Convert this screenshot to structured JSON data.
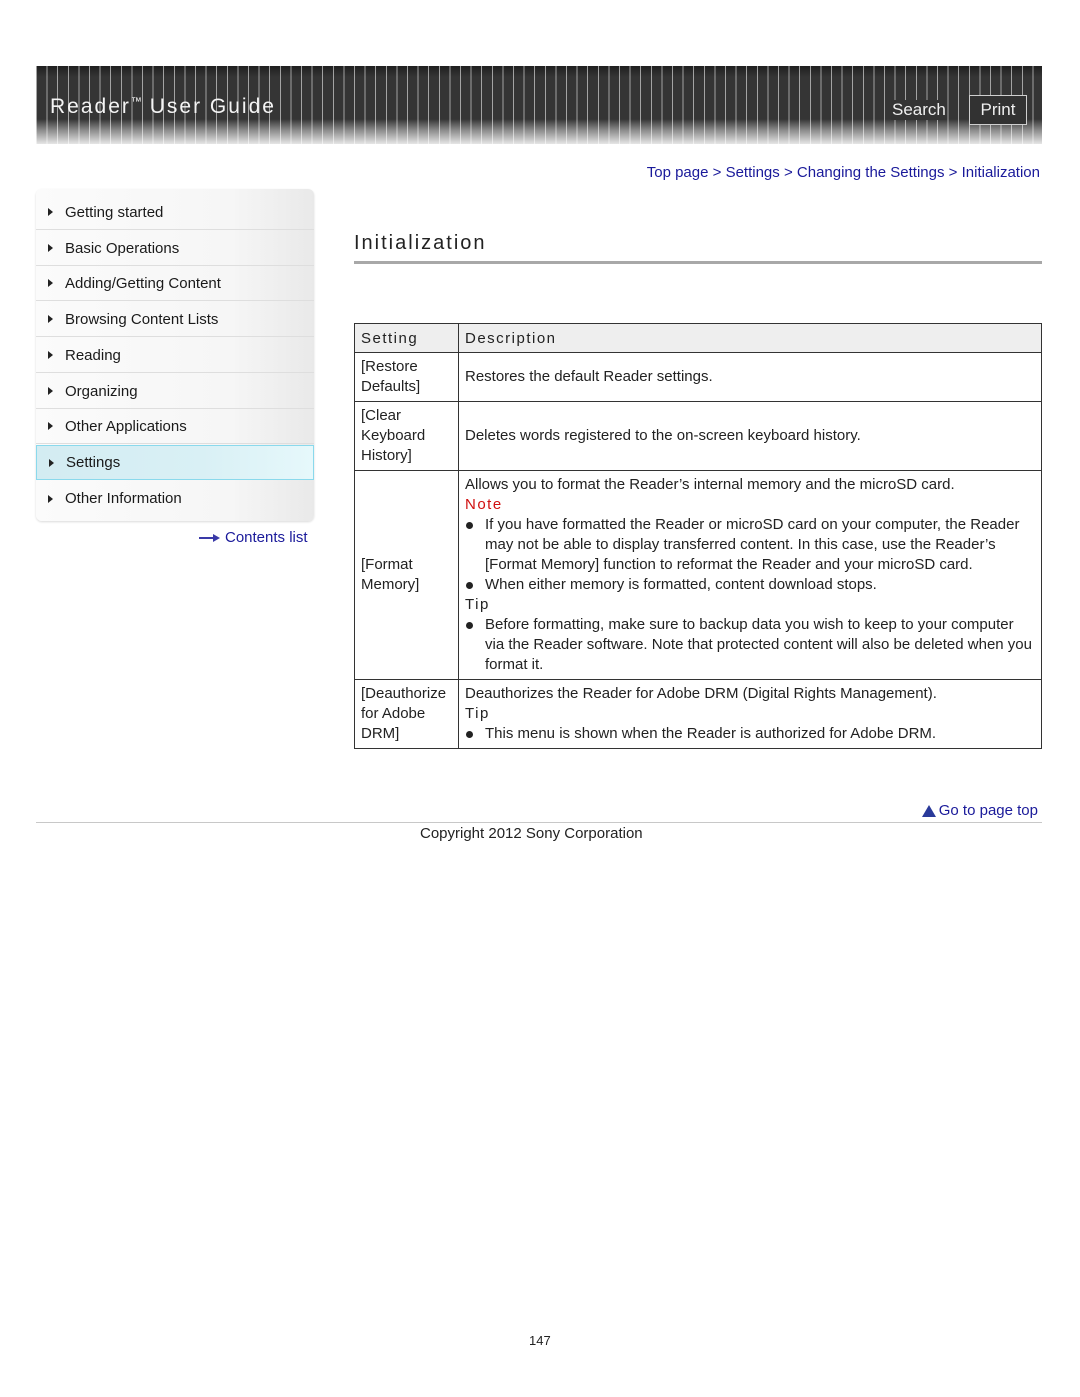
{
  "header": {
    "title_main": "Reader",
    "title_tm": "™",
    "title_rest": "User Guide",
    "search_label": "Search",
    "print_label": "Print"
  },
  "sidebar": {
    "items": [
      {
        "label": "Getting started",
        "active": false
      },
      {
        "label": "Basic Operations",
        "active": false
      },
      {
        "label": "Adding/Getting Content",
        "active": false
      },
      {
        "label": "Browsing Content Lists",
        "active": false
      },
      {
        "label": "Reading",
        "active": false
      },
      {
        "label": "Organizing",
        "active": false
      },
      {
        "label": "Other Applications",
        "active": false
      },
      {
        "label": "Settings",
        "active": true
      },
      {
        "label": "Other Information",
        "active": false
      }
    ],
    "contents_link": "Contents list"
  },
  "breadcrumb": {
    "items": [
      "Top page",
      "Settings",
      "Changing the Settings",
      "Initialization"
    ],
    "separator": ">"
  },
  "page": {
    "title": "Initialization"
  },
  "table": {
    "headers": [
      "Setting",
      "Description"
    ],
    "rows": [
      {
        "setting": "[Restore Defaults]",
        "description": "Restores the default Reader settings."
      },
      {
        "setting": "[Clear Keyboard History]",
        "description": "Deletes words registered to the on-screen keyboard history."
      },
      {
        "setting": "[Format Memory]",
        "description": "Allows you to format the Reader’s internal memory and the microSD card.",
        "note_label": "Note",
        "note_items": [
          "If you have formatted the Reader or microSD card on your computer, the Reader may not be able to display transferred content. In this case, use the Reader’s [Format Memory] function to reformat the Reader and your microSD card.",
          "When either memory is formatted, content download stops."
        ],
        "tip_label": "Tip",
        "tip_items": [
          "Before formatting, make sure to backup data you wish to keep to your computer via the Reader software. Note that protected content will also be deleted when you format it."
        ]
      },
      {
        "setting": "[Deauthorize for Adobe DRM]",
        "description": "Deauthorizes the Reader for Adobe DRM (Digital Rights Management).",
        "tip_label": "Tip",
        "tip_items": [
          "This menu is shown when the Reader is authorized for Adobe DRM."
        ]
      }
    ]
  },
  "footer": {
    "page_top_link": "Go to page top",
    "copyright": "Copyright 2012 Sony Corporation",
    "page_number": "147"
  },
  "colors": {
    "link": "#1a1a9a",
    "note": "#d01010",
    "active_nav": "#d9f0f5"
  }
}
